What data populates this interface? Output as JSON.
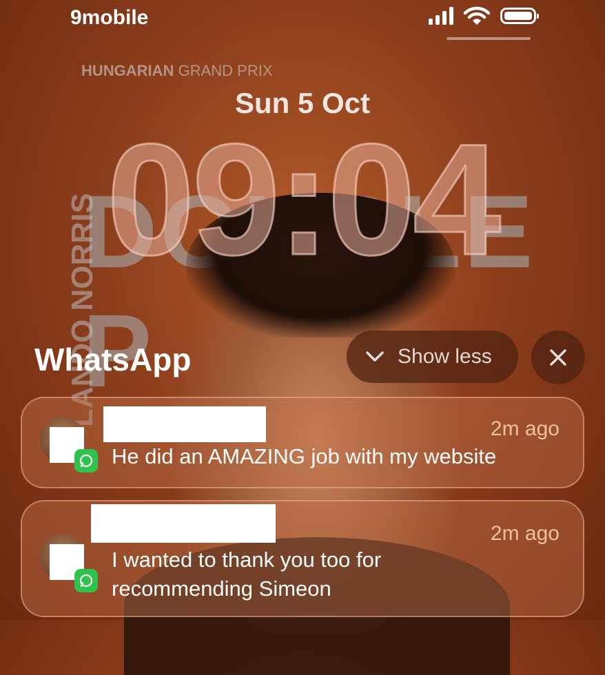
{
  "status_bar": {
    "carrier": "9mobile"
  },
  "wallpaper": {
    "event_a": "HUNGARIAN",
    "event_b": "GRAND PRIX",
    "big_text": "DOUBLE P",
    "side_text": "LANDO NORRIS"
  },
  "lock": {
    "date": "Sun 5 Oct",
    "time": "09:04"
  },
  "group": {
    "app_name": "WhatsApp",
    "show_less_label": "Show less"
  },
  "notifications": [
    {
      "time": "2m ago",
      "message": "He did an AMAZING job with my website"
    },
    {
      "time": "2m ago",
      "message_line1": "I wanted to thank you too for",
      "message_line2": "recommending Simeon"
    }
  ],
  "colors": {
    "accent_time": "#f3c29c",
    "whatsapp_green": "#2fc24d"
  }
}
